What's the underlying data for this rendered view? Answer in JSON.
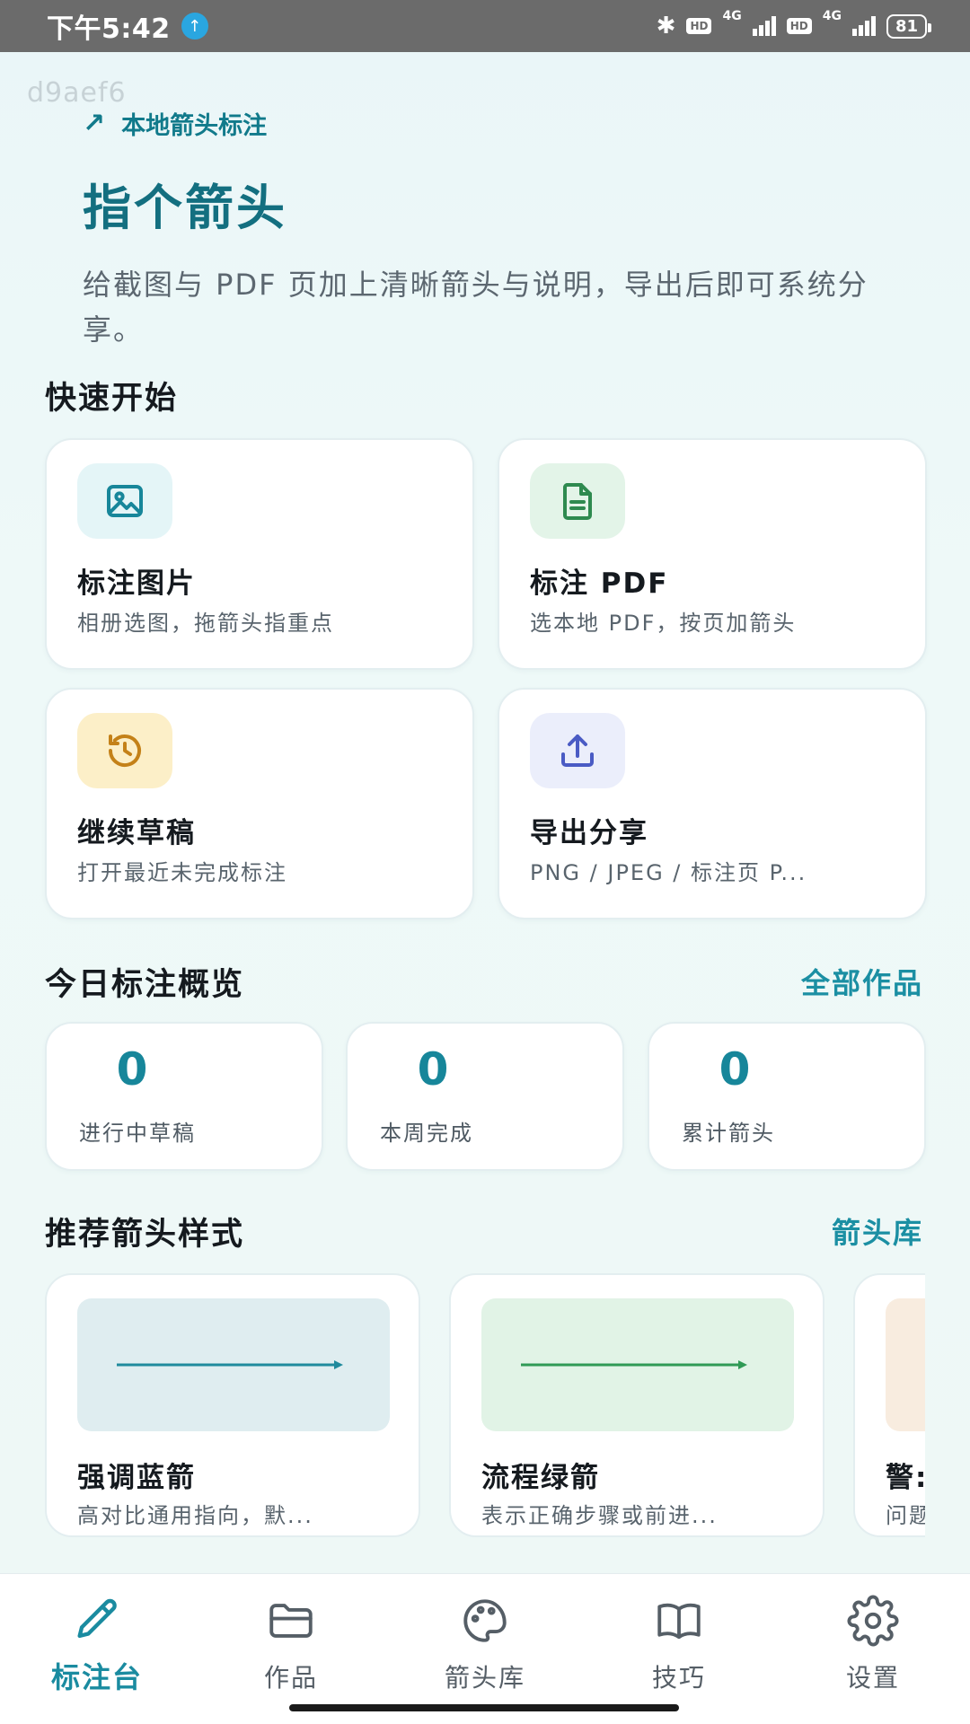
{
  "status_bar": {
    "time": "下午5:42",
    "app_notification_icon": "up-arrow-badge-icon",
    "bluetooth_icon": "bluetooth-icon",
    "sim1_badge": "HD",
    "sim1_network": "4G",
    "sim2_badge": "HD",
    "sim2_network": "4G",
    "battery": "81"
  },
  "watermark": "d9aef6",
  "hero": {
    "tag_icon": "arrow-up-right-icon",
    "tag": "本地箭头标注",
    "title": "指个箭头",
    "description": "给截图与 PDF 页加上清晰箭头与说明，导出后即可系统分享。"
  },
  "quick_start": {
    "title": "快速开始",
    "cards": [
      {
        "icon": "image-icon",
        "title": "标注图片",
        "subtitle": "相册选图，拖箭头指重点",
        "icon_bg": "#e4f5f7",
        "icon_color": "#17869a"
      },
      {
        "icon": "document-icon",
        "title": "标注 PDF",
        "subtitle": "选本地 PDF，按页加箭头",
        "icon_bg": "#e3f4e8",
        "icon_color": "#2e8a4f"
      },
      {
        "icon": "history-icon",
        "title": "继续草稿",
        "subtitle": "打开最近未完成标注",
        "icon_bg": "#fcefc8",
        "icon_color": "#c48118"
      },
      {
        "icon": "upload-icon",
        "title": "导出分享",
        "subtitle": "PNG / JPEG / 标注页 P...",
        "icon_bg": "#ebeefb",
        "icon_color": "#4a5bc4"
      }
    ]
  },
  "overview": {
    "title": "今日标注概览",
    "link": "全部作品",
    "stats": [
      {
        "value": "0",
        "label": "进行中草稿"
      },
      {
        "value": "0",
        "label": "本周完成"
      },
      {
        "value": "0",
        "label": "累计箭头"
      }
    ]
  },
  "styles": {
    "title": "推荐箭头样式",
    "link": "箭头库",
    "items": [
      {
        "name": "强调蓝箭",
        "description": "高对比通用指向，默...",
        "preview_bg": "#dfedf0",
        "arrow_color": "#1f8a9d"
      },
      {
        "name": "流程绿箭",
        "description": "表示正确步骤或前进...",
        "preview_bg": "#e1f3e6",
        "arrow_color": "#2f9a55"
      },
      {
        "name": "警:",
        "description": "问题",
        "preview_bg": "#f8ecdf",
        "arrow_color": "#d08a3a"
      }
    ]
  },
  "tabbar": {
    "tabs": [
      {
        "icon": "pencil-icon",
        "label": "标注台",
        "active": true
      },
      {
        "icon": "folder-icon",
        "label": "作品",
        "active": false
      },
      {
        "icon": "palette-icon",
        "label": "箭头库",
        "active": false
      },
      {
        "icon": "book-icon",
        "label": "技巧",
        "active": false
      },
      {
        "icon": "gear-icon",
        "label": "设置",
        "active": false
      }
    ]
  },
  "colors": {
    "accent": "#17869a",
    "title": "#136f80",
    "inactive_tab": "#555e66"
  }
}
